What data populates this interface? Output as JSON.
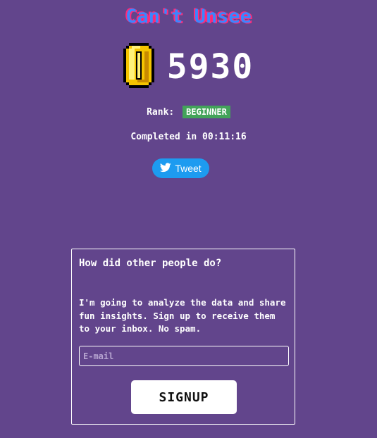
{
  "header": {
    "title": "Can't Unsee"
  },
  "score": {
    "coin_icon": "coin-icon",
    "value": "5930"
  },
  "rank": {
    "label": "Rank:",
    "value": "BEGINNER",
    "badge_color": "#43a35a"
  },
  "completion": {
    "text": "Completed in 00:11:16"
  },
  "share": {
    "tweet_label": "Tweet",
    "icon": "twitter-bird-icon",
    "color": "#1d9bf0"
  },
  "signup_panel": {
    "heading": "How did other people do?",
    "description": "I'm going to analyze the data and share fun insights. Sign up to receive them to your inbox. No spam.",
    "email_placeholder": "E-mail",
    "email_value": "",
    "button_label": "SIGNUP"
  },
  "colors": {
    "background": "#62458c",
    "title_main": "#3b86ff",
    "title_shadow": "#ff2b7a"
  }
}
